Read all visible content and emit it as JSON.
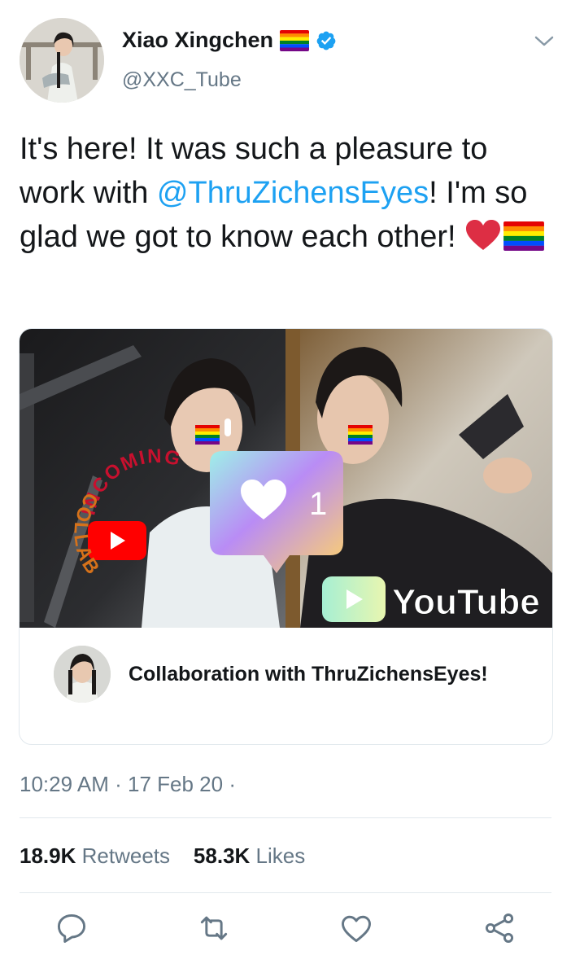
{
  "author": {
    "name": "Xiao Xingchen",
    "handle": "@XXC_Tube",
    "verified_icon": "verified-badge-icon",
    "flag_icon": "rainbow-flag-icon",
    "menu_icon": "chevron-down-icon"
  },
  "tweet": {
    "text_1": "It's here! It was such a pleasure to work with ",
    "mention": "@ThruZichensEyes",
    "text_2": "! I'm so glad we got to know each other! ",
    "emoji": [
      "red-heart-icon",
      "rainbow-flag-icon"
    ]
  },
  "card": {
    "image_text": {
      "arc_top": "INCOMING",
      "arc_bottom": "COLLAB",
      "like_count": "1",
      "platform": "YouTube"
    },
    "title": "Collaboration with ThruZichensEyes!"
  },
  "meta": {
    "time": "10:29 AM",
    "date": "17 Feb 20",
    "separator": "·"
  },
  "stats": {
    "retweets_count": "18.9K",
    "retweets_label": "Retweets",
    "likes_count": "58.3K",
    "likes_label": "Likes"
  },
  "actions": [
    "reply-icon",
    "retweet-icon",
    "like-icon",
    "share-icon"
  ],
  "colors": {
    "text": "#14171a",
    "secondary": "#657786",
    "link": "#1da1f2",
    "border": "#e1e8ed",
    "youtube_red": "#ff0000"
  }
}
